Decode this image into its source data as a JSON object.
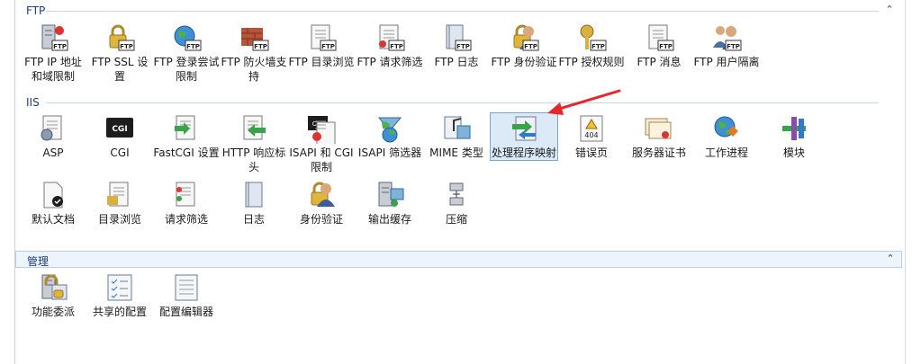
{
  "sections": {
    "ftp": {
      "title": "FTP",
      "items": [
        {
          "label": "FTP IP 地址和域限制",
          "icon": "ftp-ip-restriction-icon"
        },
        {
          "label": "FTP SSL 设置",
          "icon": "ftp-ssl-lock-icon"
        },
        {
          "label": "FTP 登录尝试限制",
          "icon": "ftp-logon-globe-icon"
        },
        {
          "label": "FTP 防火墙支持",
          "icon": "ftp-firewall-icon"
        },
        {
          "label": "FTP 目录浏览",
          "icon": "ftp-directory-browsing-icon"
        },
        {
          "label": "FTP 请求筛选",
          "icon": "ftp-request-filtering-icon"
        },
        {
          "label": "FTP 日志",
          "icon": "ftp-logging-icon"
        },
        {
          "label": "FTP 身份验证",
          "icon": "ftp-authentication-icon"
        },
        {
          "label": "FTP 授权规则",
          "icon": "ftp-authorization-keys-icon"
        },
        {
          "label": "FTP 消息",
          "icon": "ftp-messages-icon"
        },
        {
          "label": "FTP 用户隔离",
          "icon": "ftp-user-isolation-icon"
        }
      ]
    },
    "iis": {
      "title": "IIS",
      "items": [
        {
          "label": "ASP",
          "icon": "asp-icon"
        },
        {
          "label": "CGI",
          "icon": "cgi-icon"
        },
        {
          "label": "FastCGI 设置",
          "icon": "fastcgi-icon"
        },
        {
          "label": "HTTP 响应标头",
          "icon": "http-response-headers-icon"
        },
        {
          "label": "ISAPI 和 CGI 限制",
          "icon": "isapi-cgi-restrictions-icon"
        },
        {
          "label": "ISAPI 筛选器",
          "icon": "isapi-filters-icon"
        },
        {
          "label": "MIME 类型",
          "icon": "mime-types-icon"
        },
        {
          "label": "处理程序映射",
          "icon": "handler-mappings-icon",
          "selected": true
        },
        {
          "label": "错误页",
          "icon": "error-pages-icon"
        },
        {
          "label": "服务器证书",
          "icon": "server-certificates-icon"
        },
        {
          "label": "工作进程",
          "icon": "worker-processes-icon"
        },
        {
          "label": "模块",
          "icon": "modules-icon"
        },
        {
          "label": "默认文档",
          "icon": "default-document-icon"
        },
        {
          "label": "目录浏览",
          "icon": "directory-browsing-icon"
        },
        {
          "label": "请求筛选",
          "icon": "request-filtering-icon"
        },
        {
          "label": "日志",
          "icon": "logging-icon"
        },
        {
          "label": "身份验证",
          "icon": "authentication-icon"
        },
        {
          "label": "输出缓存",
          "icon": "output-caching-icon"
        },
        {
          "label": "压缩",
          "icon": "compression-icon"
        }
      ]
    },
    "management": {
      "title": "管理",
      "items": [
        {
          "label": "功能委派",
          "icon": "feature-delegation-icon"
        },
        {
          "label": "共享的配置",
          "icon": "shared-configuration-icon"
        },
        {
          "label": "配置编辑器",
          "icon": "configuration-editor-icon"
        }
      ]
    }
  },
  "icon_badges": {
    "ftp": "FTP",
    "cgi": "CGI",
    "error_code": "404"
  },
  "colors": {
    "section_title": "#1e3d7b",
    "selection_bg": "#dceaf8",
    "selection_border": "#7da2ce",
    "arrow": "#e8262a"
  }
}
